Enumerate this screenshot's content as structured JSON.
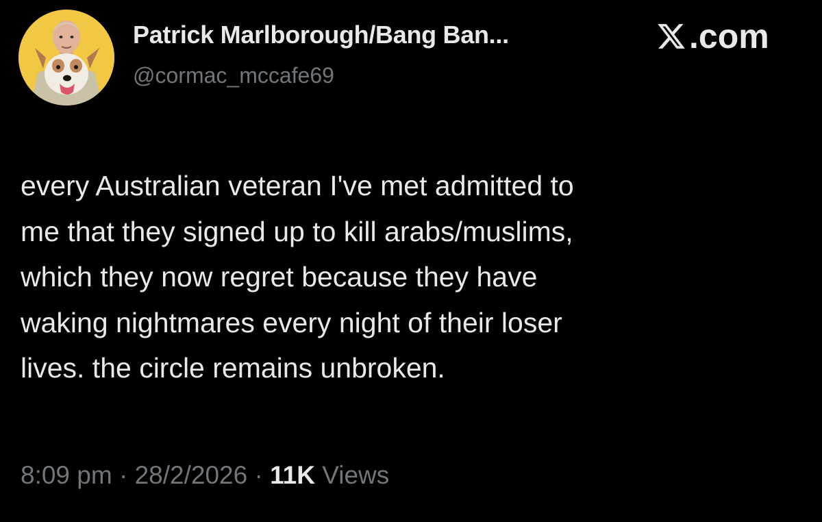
{
  "author": {
    "display_name": "Patrick Marlborough/Bang Ban...",
    "handle": "@cormac_mccafe69",
    "avatar_icon": "avatar-man-with-dog"
  },
  "source": {
    "label": ".com",
    "logo_icon": "x-logo-icon"
  },
  "tweet": {
    "lines": [
      "every Australian veteran I've met admitted to",
      "me that they signed up to kill arabs/muslims,",
      "which they now regret because they have",
      "waking nightmares every night of their loser",
      "lives. the circle remains unbroken."
    ]
  },
  "meta": {
    "time": "8:09 pm",
    "separator": " · ",
    "date": "28/2/2026",
    "views_count": "11K",
    "views_label": " Views"
  },
  "colors": {
    "background": "#000000",
    "primary_text": "#e7e9ea",
    "secondary_text": "#71767b",
    "avatar_bg": "#f2c744"
  }
}
